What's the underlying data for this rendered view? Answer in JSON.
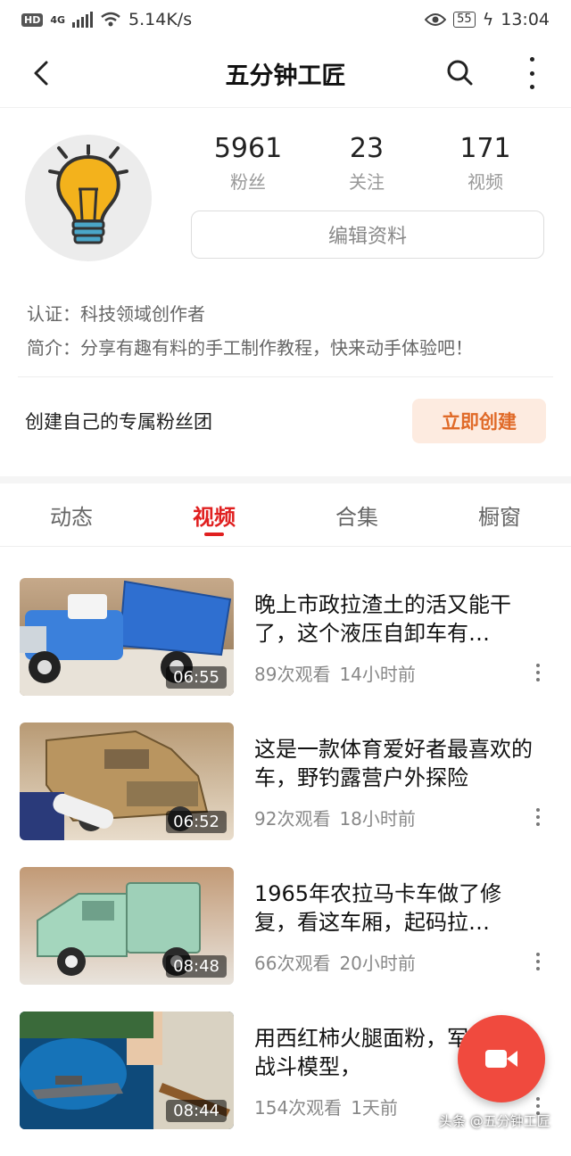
{
  "status_bar": {
    "hd": "HD",
    "net": "4G",
    "speed": "5.14K/s",
    "battery": "55",
    "time": "13:04"
  },
  "header": {
    "title": "五分钟工匠"
  },
  "profile": {
    "stats": [
      {
        "num": "5961",
        "label": "粉丝"
      },
      {
        "num": "23",
        "label": "关注"
      },
      {
        "num": "171",
        "label": "视频"
      }
    ],
    "edit_label": "编辑资料",
    "cert": "认证：科技领域创作者",
    "bio": "简介：分享有趣有料的手工制作教程，快来动手体验吧！"
  },
  "fans_group": {
    "text": "创建自己的专属粉丝团",
    "button": "立即创建"
  },
  "tabs": [
    {
      "label": "动态"
    },
    {
      "label": "视频"
    },
    {
      "label": "合集"
    },
    {
      "label": "橱窗"
    }
  ],
  "videos": [
    {
      "title": "晚上市政拉渣土的活又能干了，这个液压自卸车有…",
      "views": "89次观看",
      "time": "14小时前",
      "duration": "06:55"
    },
    {
      "title": "这是一款体育爱好者最喜欢的车，野钓露营户外探险",
      "views": "92次观看",
      "time": "18小时前",
      "duration": "06:52"
    },
    {
      "title": "1965年农拉马卡车做了修复，看这车厢，起码拉…",
      "views": "66次观看",
      "time": "20小时前",
      "duration": "08:48"
    },
    {
      "title": "用西红柿火腿面粉，军舰海洋战斗模型，",
      "views": "154次观看",
      "time": "1天前",
      "duration": "08:44"
    }
  ],
  "watermark": "头条 @五分钟工匠",
  "colors": {
    "accent": "#e02020",
    "fab": "#f04a3e",
    "create_btn_text": "#e06a28"
  }
}
